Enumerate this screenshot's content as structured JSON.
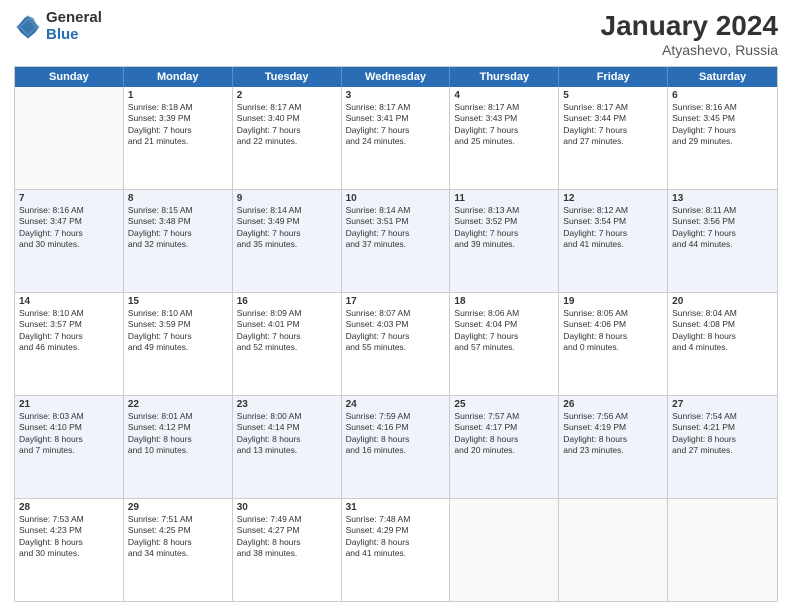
{
  "header": {
    "logo": {
      "general": "General",
      "blue": "Blue"
    },
    "title": "January 2024",
    "location": "Atyashevo, Russia"
  },
  "calendar": {
    "days": [
      "Sunday",
      "Monday",
      "Tuesday",
      "Wednesday",
      "Thursday",
      "Friday",
      "Saturday"
    ],
    "rows": [
      [
        {
          "num": "",
          "lines": []
        },
        {
          "num": "1",
          "lines": [
            "Sunrise: 8:18 AM",
            "Sunset: 3:39 PM",
            "Daylight: 7 hours",
            "and 21 minutes."
          ]
        },
        {
          "num": "2",
          "lines": [
            "Sunrise: 8:17 AM",
            "Sunset: 3:40 PM",
            "Daylight: 7 hours",
            "and 22 minutes."
          ]
        },
        {
          "num": "3",
          "lines": [
            "Sunrise: 8:17 AM",
            "Sunset: 3:41 PM",
            "Daylight: 7 hours",
            "and 24 minutes."
          ]
        },
        {
          "num": "4",
          "lines": [
            "Sunrise: 8:17 AM",
            "Sunset: 3:43 PM",
            "Daylight: 7 hours",
            "and 25 minutes."
          ]
        },
        {
          "num": "5",
          "lines": [
            "Sunrise: 8:17 AM",
            "Sunset: 3:44 PM",
            "Daylight: 7 hours",
            "and 27 minutes."
          ]
        },
        {
          "num": "6",
          "lines": [
            "Sunrise: 8:16 AM",
            "Sunset: 3:45 PM",
            "Daylight: 7 hours",
            "and 29 minutes."
          ]
        }
      ],
      [
        {
          "num": "7",
          "lines": [
            "Sunrise: 8:16 AM",
            "Sunset: 3:47 PM",
            "Daylight: 7 hours",
            "and 30 minutes."
          ]
        },
        {
          "num": "8",
          "lines": [
            "Sunrise: 8:15 AM",
            "Sunset: 3:48 PM",
            "Daylight: 7 hours",
            "and 32 minutes."
          ]
        },
        {
          "num": "9",
          "lines": [
            "Sunrise: 8:14 AM",
            "Sunset: 3:49 PM",
            "Daylight: 7 hours",
            "and 35 minutes."
          ]
        },
        {
          "num": "10",
          "lines": [
            "Sunrise: 8:14 AM",
            "Sunset: 3:51 PM",
            "Daylight: 7 hours",
            "and 37 minutes."
          ]
        },
        {
          "num": "11",
          "lines": [
            "Sunrise: 8:13 AM",
            "Sunset: 3:52 PM",
            "Daylight: 7 hours",
            "and 39 minutes."
          ]
        },
        {
          "num": "12",
          "lines": [
            "Sunrise: 8:12 AM",
            "Sunset: 3:54 PM",
            "Daylight: 7 hours",
            "and 41 minutes."
          ]
        },
        {
          "num": "13",
          "lines": [
            "Sunrise: 8:11 AM",
            "Sunset: 3:56 PM",
            "Daylight: 7 hours",
            "and 44 minutes."
          ]
        }
      ],
      [
        {
          "num": "14",
          "lines": [
            "Sunrise: 8:10 AM",
            "Sunset: 3:57 PM",
            "Daylight: 7 hours",
            "and 46 minutes."
          ]
        },
        {
          "num": "15",
          "lines": [
            "Sunrise: 8:10 AM",
            "Sunset: 3:59 PM",
            "Daylight: 7 hours",
            "and 49 minutes."
          ]
        },
        {
          "num": "16",
          "lines": [
            "Sunrise: 8:09 AM",
            "Sunset: 4:01 PM",
            "Daylight: 7 hours",
            "and 52 minutes."
          ]
        },
        {
          "num": "17",
          "lines": [
            "Sunrise: 8:07 AM",
            "Sunset: 4:03 PM",
            "Daylight: 7 hours",
            "and 55 minutes."
          ]
        },
        {
          "num": "18",
          "lines": [
            "Sunrise: 8:06 AM",
            "Sunset: 4:04 PM",
            "Daylight: 7 hours",
            "and 57 minutes."
          ]
        },
        {
          "num": "19",
          "lines": [
            "Sunrise: 8:05 AM",
            "Sunset: 4:06 PM",
            "Daylight: 8 hours",
            "and 0 minutes."
          ]
        },
        {
          "num": "20",
          "lines": [
            "Sunrise: 8:04 AM",
            "Sunset: 4:08 PM",
            "Daylight: 8 hours",
            "and 4 minutes."
          ]
        }
      ],
      [
        {
          "num": "21",
          "lines": [
            "Sunrise: 8:03 AM",
            "Sunset: 4:10 PM",
            "Daylight: 8 hours",
            "and 7 minutes."
          ]
        },
        {
          "num": "22",
          "lines": [
            "Sunrise: 8:01 AM",
            "Sunset: 4:12 PM",
            "Daylight: 8 hours",
            "and 10 minutes."
          ]
        },
        {
          "num": "23",
          "lines": [
            "Sunrise: 8:00 AM",
            "Sunset: 4:14 PM",
            "Daylight: 8 hours",
            "and 13 minutes."
          ]
        },
        {
          "num": "24",
          "lines": [
            "Sunrise: 7:59 AM",
            "Sunset: 4:16 PM",
            "Daylight: 8 hours",
            "and 16 minutes."
          ]
        },
        {
          "num": "25",
          "lines": [
            "Sunrise: 7:57 AM",
            "Sunset: 4:17 PM",
            "Daylight: 8 hours",
            "and 20 minutes."
          ]
        },
        {
          "num": "26",
          "lines": [
            "Sunrise: 7:56 AM",
            "Sunset: 4:19 PM",
            "Daylight: 8 hours",
            "and 23 minutes."
          ]
        },
        {
          "num": "27",
          "lines": [
            "Sunrise: 7:54 AM",
            "Sunset: 4:21 PM",
            "Daylight: 8 hours",
            "and 27 minutes."
          ]
        }
      ],
      [
        {
          "num": "28",
          "lines": [
            "Sunrise: 7:53 AM",
            "Sunset: 4:23 PM",
            "Daylight: 8 hours",
            "and 30 minutes."
          ]
        },
        {
          "num": "29",
          "lines": [
            "Sunrise: 7:51 AM",
            "Sunset: 4:25 PM",
            "Daylight: 8 hours",
            "and 34 minutes."
          ]
        },
        {
          "num": "30",
          "lines": [
            "Sunrise: 7:49 AM",
            "Sunset: 4:27 PM",
            "Daylight: 8 hours",
            "and 38 minutes."
          ]
        },
        {
          "num": "31",
          "lines": [
            "Sunrise: 7:48 AM",
            "Sunset: 4:29 PM",
            "Daylight: 8 hours",
            "and 41 minutes."
          ]
        },
        {
          "num": "",
          "lines": []
        },
        {
          "num": "",
          "lines": []
        },
        {
          "num": "",
          "lines": []
        }
      ]
    ]
  }
}
